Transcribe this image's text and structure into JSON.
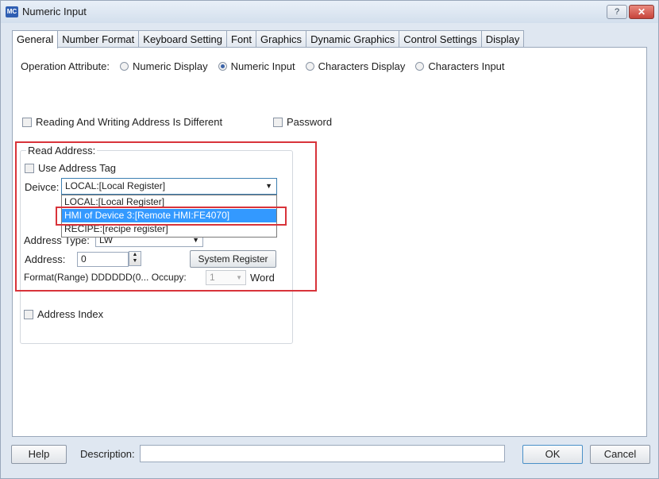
{
  "window": {
    "icon_text": "MC",
    "title": "Numeric Input",
    "help_button": "?",
    "close_button": "✕"
  },
  "tabs": [
    {
      "label": "General",
      "active": true
    },
    {
      "label": "Number Format"
    },
    {
      "label": "Keyboard Setting"
    },
    {
      "label": "Font"
    },
    {
      "label": "Graphics"
    },
    {
      "label": "Dynamic Graphics"
    },
    {
      "label": "Control Settings"
    },
    {
      "label": "Display"
    }
  ],
  "operation": {
    "label": "Operation Attribute:",
    "options": [
      {
        "label": "Numeric Display",
        "selected": false
      },
      {
        "label": "Numeric Input",
        "selected": true
      },
      {
        "label": "Characters Display",
        "selected": false
      },
      {
        "label": "Characters Input",
        "selected": false
      }
    ]
  },
  "checkboxes": {
    "rw_different": "Reading And Writing Address Is Different",
    "password": "Password",
    "use_tag": "Use Address Tag",
    "address_index": "Address Index"
  },
  "read_address": {
    "group_label": "Read Address:",
    "device_label": "Deivce:",
    "device_value": "LOCAL:[Local Register]",
    "device_options": [
      "LOCAL:[Local Register]",
      "HMI of Device 3:[Remote HMI:FE4070]",
      "RECIPE:[recipe register]"
    ],
    "device_highlighted": "HMI of Device 3:[Remote HMI:FE4070]",
    "address_type_label": "Address Type:",
    "address_type_value": "LW",
    "address_label": "Address:",
    "address_value": "0",
    "system_register": "System Register",
    "format_label": "Format(Range)",
    "format_value": "DDDDDD(0...",
    "occupy_label": "Occupy:",
    "occupy_value": "1",
    "word_label": "Word"
  },
  "footer": {
    "help": "Help",
    "description_label": "Description:",
    "description_value": "",
    "ok": "OK",
    "cancel": "Cancel"
  },
  "colors": {
    "highlight_red": "#d8333a",
    "selection_blue": "#3399ff",
    "window_bg": "#dfe7f1"
  }
}
